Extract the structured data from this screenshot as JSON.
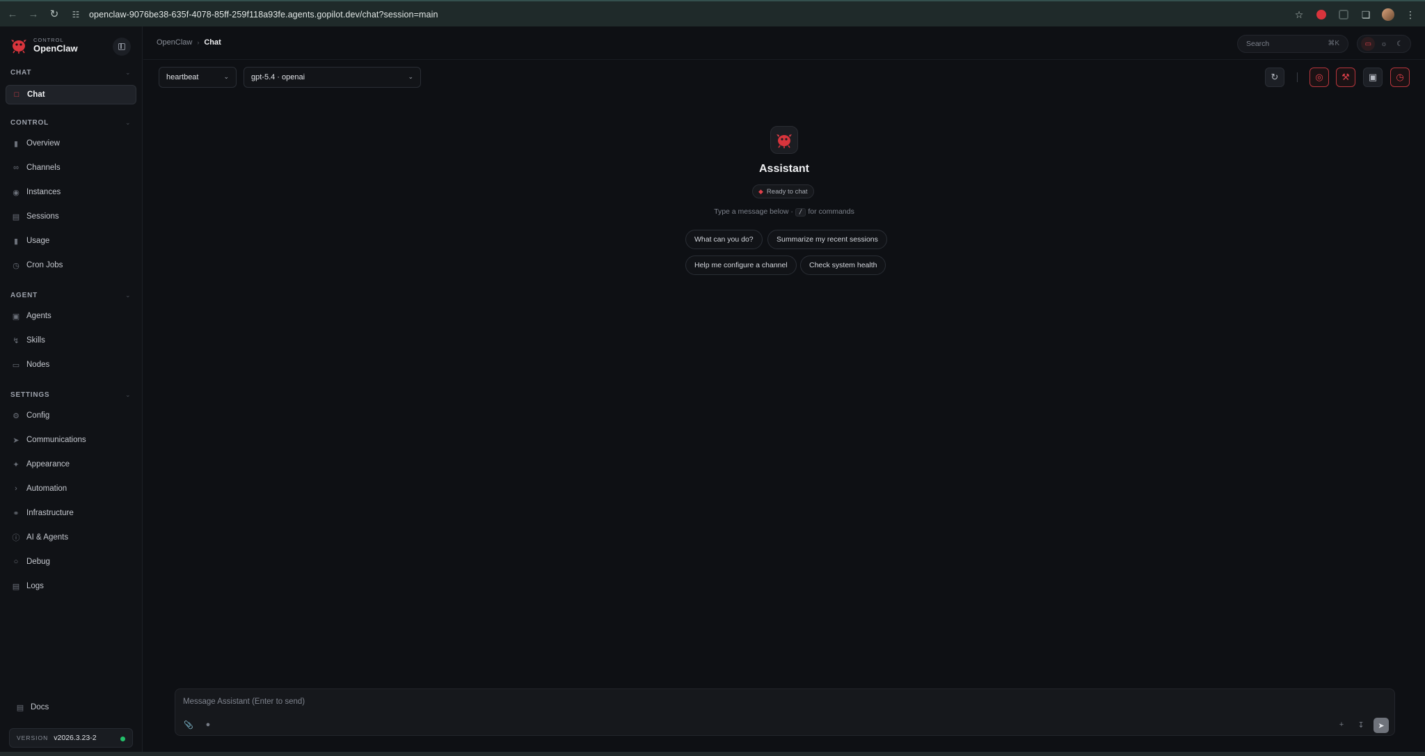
{
  "browser": {
    "url": "openclaw-9076be38-635f-4078-85ff-259f118a93fe.agents.gopilot.dev/chat?session=main"
  },
  "brand": {
    "sub": "CONTROL",
    "name": "OpenClaw",
    "accent": "#e0404a"
  },
  "sidebar": {
    "sections": [
      {
        "title": "CHAT",
        "items": [
          {
            "label": "Chat",
            "icon": "chat-bubble-icon",
            "active": true
          }
        ]
      },
      {
        "title": "CONTROL",
        "items": [
          {
            "label": "Overview",
            "icon": "bar-chart-icon"
          },
          {
            "label": "Channels",
            "icon": "link-icon"
          },
          {
            "label": "Instances",
            "icon": "radio-icon"
          },
          {
            "label": "Sessions",
            "icon": "document-icon"
          },
          {
            "label": "Usage",
            "icon": "bar-chart-icon"
          },
          {
            "label": "Cron Jobs",
            "icon": "clock-icon"
          }
        ]
      },
      {
        "title": "AGENT",
        "items": [
          {
            "label": "Agents",
            "icon": "folder-icon"
          },
          {
            "label": "Skills",
            "icon": "bolt-icon"
          },
          {
            "label": "Nodes",
            "icon": "monitor-icon"
          }
        ]
      },
      {
        "title": "SETTINGS",
        "items": [
          {
            "label": "Config",
            "icon": "gear-icon"
          },
          {
            "label": "Communications",
            "icon": "send-icon"
          },
          {
            "label": "Appearance",
            "icon": "sparkle-icon"
          },
          {
            "label": "Automation",
            "icon": "terminal-icon"
          },
          {
            "label": "Infrastructure",
            "icon": "globe-icon"
          },
          {
            "label": "AI & Agents",
            "icon": "info-icon"
          },
          {
            "label": "Debug",
            "icon": "bug-icon"
          },
          {
            "label": "Logs",
            "icon": "scroll-icon"
          }
        ]
      }
    ],
    "docs_label": "Docs",
    "version_key": "VERSION",
    "version_value": "v2026.3.23-2",
    "status_color": "#23c06a"
  },
  "header": {
    "breadcrumb_root": "OpenClaw",
    "breadcrumb_current": "Chat",
    "search_placeholder": "Search",
    "search_shortcut": "⌘K"
  },
  "toolbar": {
    "session_select": "heartbeat",
    "model_select": "gpt-5.4 · openai"
  },
  "welcome": {
    "name": "Assistant",
    "status": "Ready to chat",
    "hint_before": "Type a message below ·",
    "hint_key": "/",
    "hint_after": "for commands",
    "suggestions": [
      "What can you do?",
      "Summarize my recent sessions",
      "Help me configure a channel",
      "Check system health"
    ]
  },
  "composer": {
    "placeholder": "Message Assistant (Enter to send)"
  }
}
